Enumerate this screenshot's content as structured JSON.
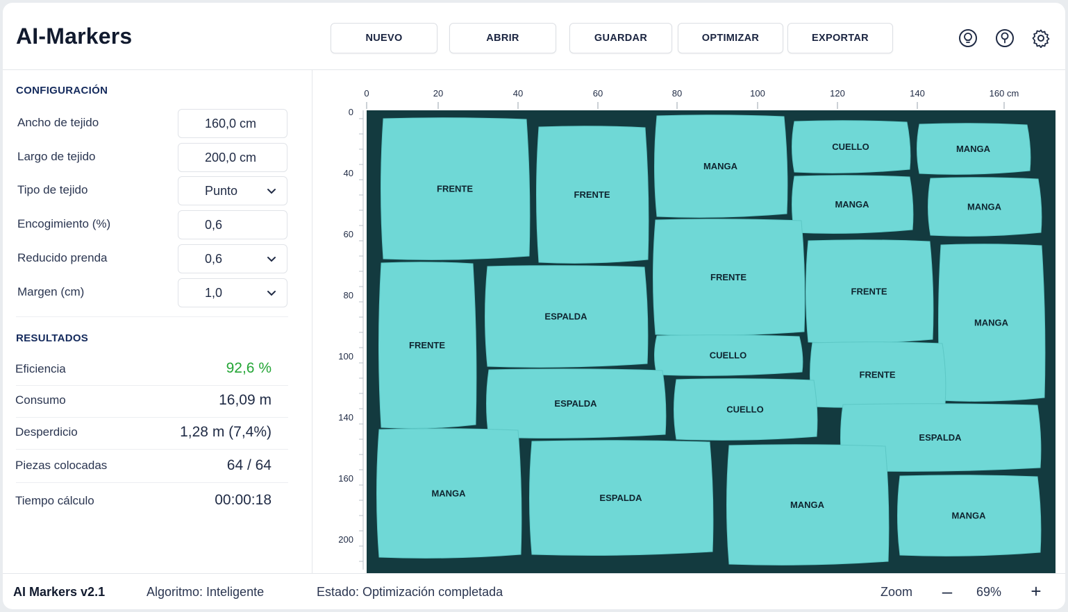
{
  "app": {
    "title": "AI-Markers"
  },
  "toolbar": {
    "buttons": [
      "NUEVO",
      "ABRIR",
      "GUARDAR",
      "OPTIMIZAR",
      "EXPORTAR"
    ],
    "icons": [
      "lightbulb-icon",
      "help-icon",
      "gear-icon"
    ]
  },
  "config": {
    "title": "CONFIGURACIÓN",
    "fields": [
      {
        "label": "Ancho de tejido",
        "value": "160,0 cm",
        "type": "input"
      },
      {
        "label": "Largo de tejido",
        "value": "200,0 cm",
        "type": "input"
      },
      {
        "label": "Tipo de tejido",
        "value": "Punto",
        "type": "select"
      },
      {
        "label": "Encogimiento (%)",
        "value": "0,6",
        "type": "input"
      },
      {
        "label": "Reducido prenda",
        "value": "0,6",
        "type": "select"
      },
      {
        "label": "Margen (cm)",
        "value": "1,0",
        "type": "select"
      }
    ]
  },
  "results": {
    "title": "RESULTADOS",
    "rows": [
      {
        "label": "Eficiencia",
        "value": "92,6 %"
      },
      {
        "label": "Consumo",
        "value": "16,09 m"
      },
      {
        "label": "Desperdicio",
        "value": "1,28 m (7,4%)"
      },
      {
        "label": "Piezas colocadas",
        "value": "64 / 64"
      },
      {
        "label": "Tiempo cálculo",
        "value": "00:00:18"
      }
    ],
    "highlight_color": "#23a535"
  },
  "marker": {
    "x_ticks": [
      "0",
      "20",
      "40",
      "60",
      "80",
      "100",
      "120",
      "140",
      "160 cm"
    ],
    "y_ticks": [
      "0",
      "40",
      "60",
      "80",
      "100",
      "140",
      "160",
      "200"
    ],
    "fabric_color": "#133a3f",
    "piece_color": "#6fd8d6",
    "piece_labels": [
      "FRENTE",
      "FRENTE",
      "MANGA",
      "CUELLO",
      "MANGA",
      "MANGA",
      "MANGA",
      "FRENTE",
      "ESPALDA",
      "FRENTE",
      "FRENTE",
      "MANGA",
      "CUELLO",
      "FRENTE",
      "ESPALDA",
      "CUELLO",
      "ESPALDA",
      "MANGA",
      "ESPALDA",
      "MANGA",
      "MANGA"
    ]
  },
  "status": {
    "version": "AI Markers v2.1",
    "algorithm": "Algoritmo: Inteligente",
    "state": "Estado: Optimización completada",
    "zoom_label": "Zoom",
    "zoom_minus": "–",
    "zoom_value": "69%",
    "zoom_plus": "+"
  }
}
